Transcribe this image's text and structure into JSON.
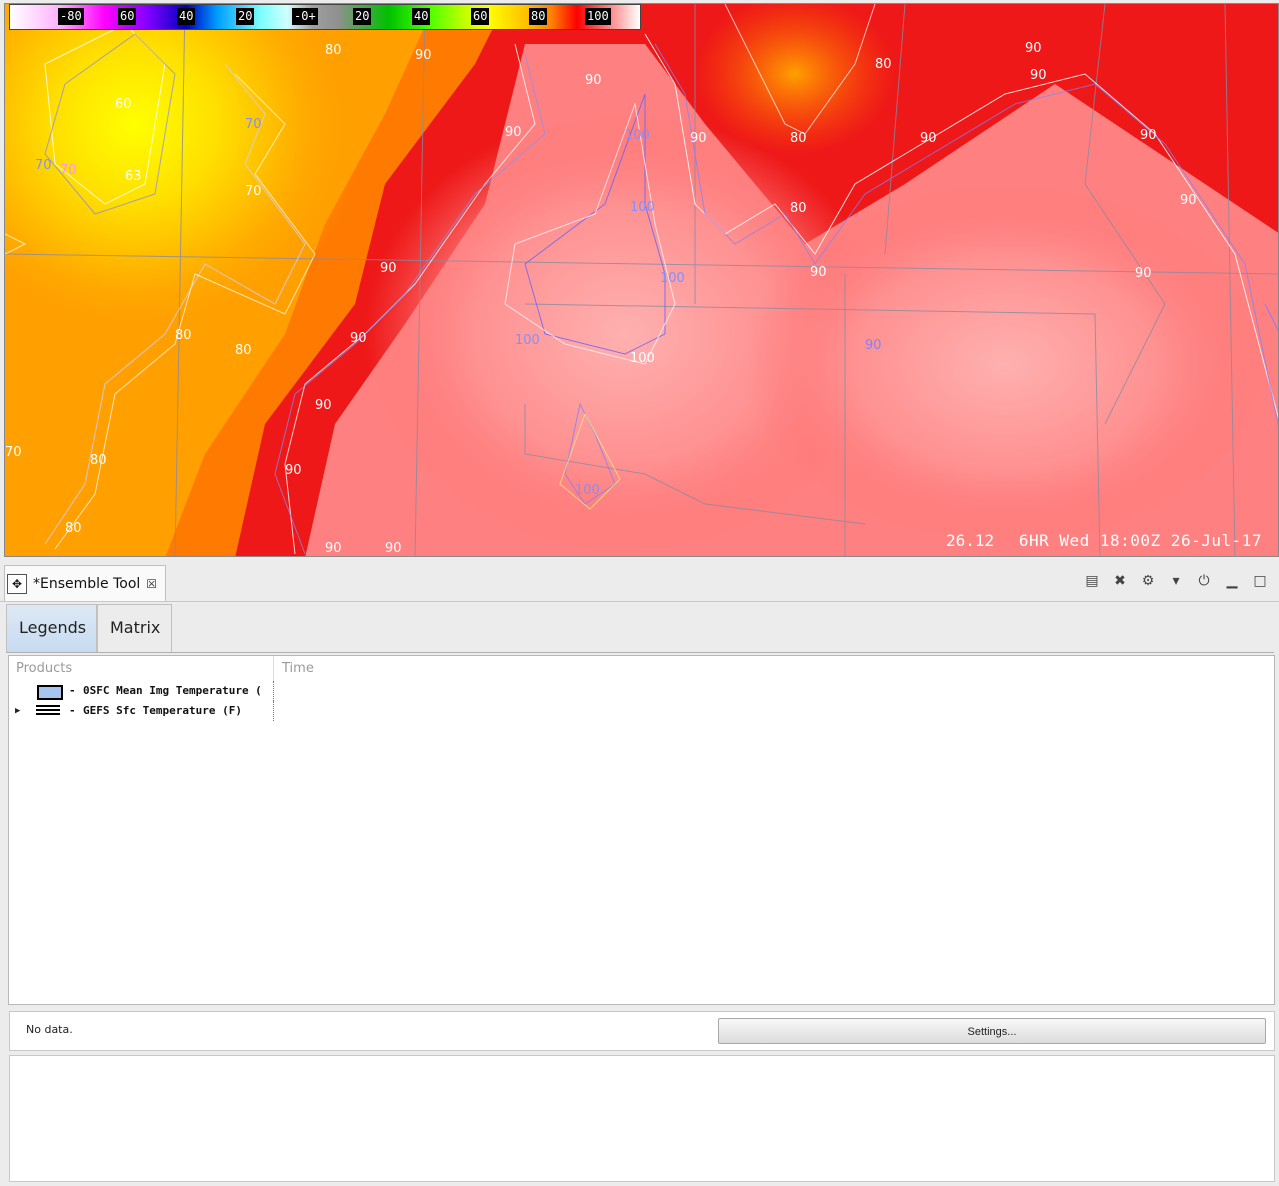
{
  "map": {
    "colorbar_ticks": [
      "-80",
      "60",
      "40",
      "20",
      "-0+",
      "20",
      "40",
      "60",
      "80",
      "100"
    ],
    "frame_value": "26.12",
    "time_label": "6HR Wed 18:00Z 26-Jul-17",
    "contour_labels": [
      "70",
      "70",
      "80",
      "80",
      "80",
      "90",
      "90",
      "90",
      "90",
      "90",
      "100",
      "100",
      "100",
      "100",
      "100",
      "90",
      "90",
      "80",
      "70",
      "90",
      "90",
      "90"
    ]
  },
  "view": {
    "tab_label": "*Ensemble Tool",
    "tab_icon": "move-arrows-icon",
    "toolbar_icons": [
      "notepad-icon",
      "tools-icon",
      "gear-icon",
      "dropdown-arrow-icon",
      "power-icon",
      "minimize-icon",
      "maximize-icon"
    ]
  },
  "tabs": {
    "legends": "Legends",
    "matrix": "Matrix"
  },
  "legend_table": {
    "col_products": "Products",
    "col_time": "Time",
    "rows": [
      {
        "label": "0SFC Mean Img Temperature (",
        "swatch": "box",
        "color": "#a7c5f0",
        "expandable": false
      },
      {
        "label": "GEFS Sfc Temperature (F)",
        "swatch": "lines",
        "expandable": true
      }
    ]
  },
  "status": {
    "message": "No data.",
    "settings_label": "Settings..."
  }
}
